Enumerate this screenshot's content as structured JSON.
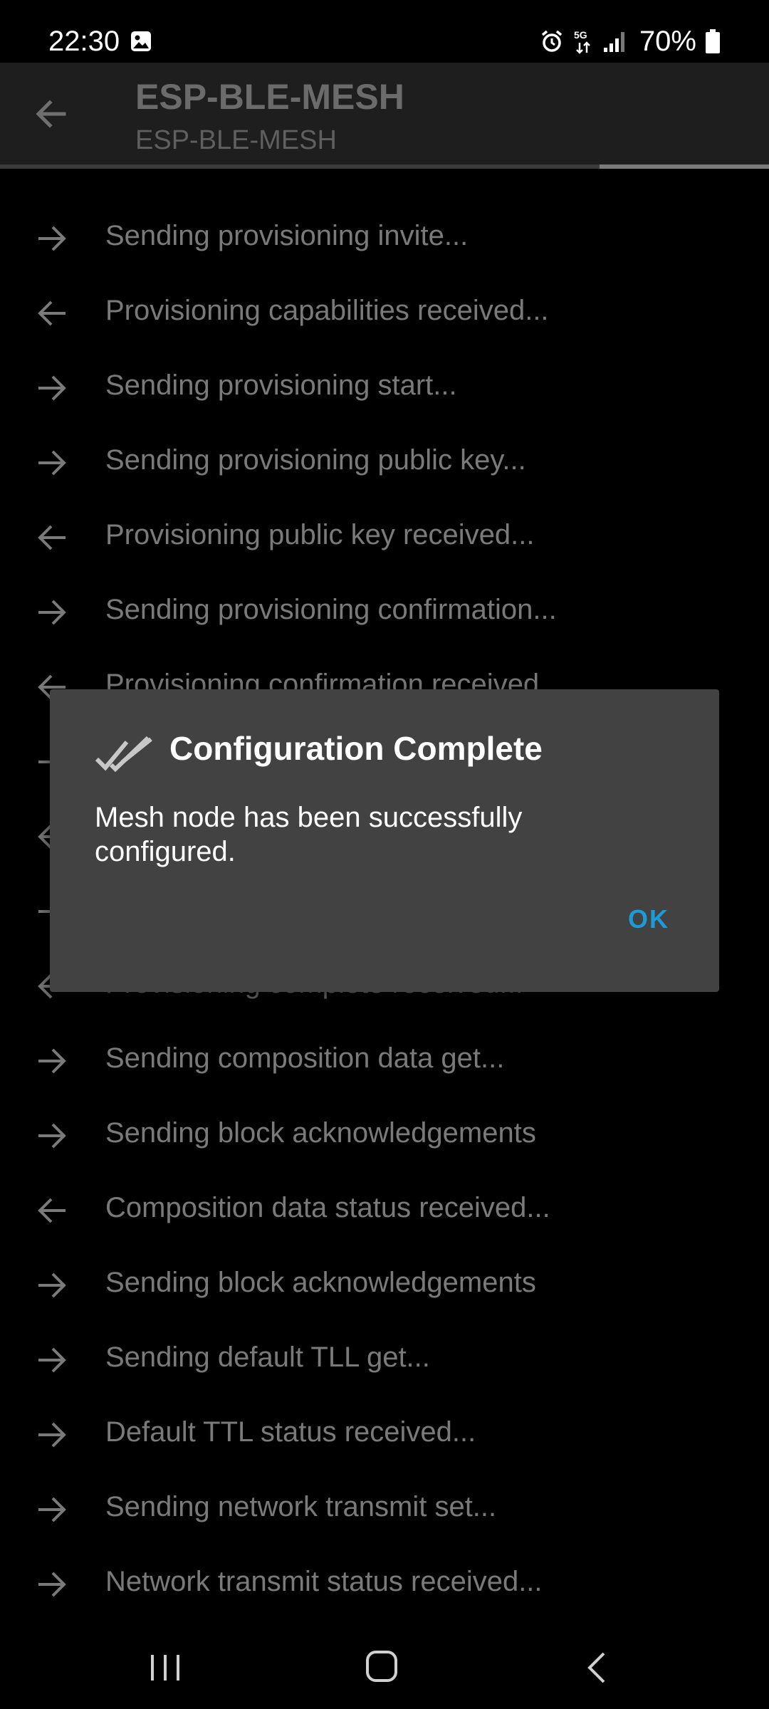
{
  "status_bar": {
    "time": "22:30",
    "network": "5G",
    "battery": "70%",
    "icons": [
      "gallery-icon",
      "alarm-icon",
      "network-5g-icon",
      "signal-icon",
      "battery-icon"
    ]
  },
  "app_bar": {
    "title": "ESP-BLE-MESH",
    "subtitle": "ESP-BLE-MESH",
    "progress_fraction": 0.22
  },
  "log": {
    "items": [
      {
        "direction": "out",
        "text": "Sending provisioning invite..."
      },
      {
        "direction": "in",
        "text": "Provisioning capabilities received..."
      },
      {
        "direction": "out",
        "text": "Sending provisioning start..."
      },
      {
        "direction": "out",
        "text": "Sending provisioning public key..."
      },
      {
        "direction": "in",
        "text": "Provisioning public key received..."
      },
      {
        "direction": "out",
        "text": "Sending provisioning confirmation..."
      },
      {
        "direction": "in",
        "text": "Provisioning confirmation received..."
      },
      {
        "direction": "out",
        "text": ""
      },
      {
        "direction": "in",
        "text": ""
      },
      {
        "direction": "out",
        "text": ""
      },
      {
        "direction": "in",
        "text": "Provisioning complete received..."
      },
      {
        "direction": "out",
        "text": "Sending composition data get..."
      },
      {
        "direction": "out",
        "text": "Sending block acknowledgements"
      },
      {
        "direction": "in",
        "text": "Composition data status received..."
      },
      {
        "direction": "out",
        "text": "Sending block acknowledgements"
      },
      {
        "direction": "out",
        "text": "Sending default TLL get..."
      },
      {
        "direction": "out",
        "text": "Default TTL status received..."
      },
      {
        "direction": "out",
        "text": "Sending network transmit set..."
      },
      {
        "direction": "out",
        "text": "Network transmit status received..."
      }
    ]
  },
  "dialog": {
    "title": "Configuration Complete",
    "message": "Mesh node has been successfully configured.",
    "ok_label": "OK",
    "icon": "double-check-icon",
    "accent_color": "#1e9ad6"
  },
  "nav_bar": {
    "icons": [
      "recent-apps-icon",
      "home-icon",
      "back-icon"
    ]
  }
}
